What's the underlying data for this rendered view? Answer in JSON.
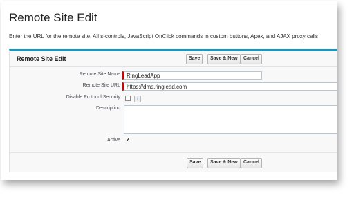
{
  "page": {
    "title": "Remote Site Edit",
    "intro": "Enter the URL for the remote site. All s-controls, JavaScript OnClick commands in custom buttons, Apex, and AJAX proxy calls"
  },
  "block": {
    "title": "Remote Site Edit",
    "buttons": {
      "save": "Save",
      "save_new": "Save & New",
      "cancel": "Cancel"
    }
  },
  "form": {
    "site_name": {
      "label": "Remote Site Name",
      "value": "RingLeadApp"
    },
    "site_url": {
      "label": "Remote Site URL",
      "value": "https://dms.ringlead.com"
    },
    "disable_protocol": {
      "label": "Disable Protocol Security",
      "checked": false,
      "info_icon": "i"
    },
    "description": {
      "label": "Description",
      "value": ""
    },
    "active": {
      "label": "Active",
      "checked": true,
      "check_mark": "✔"
    }
  },
  "colors": {
    "accent": "#1797c0",
    "required": "#cc0000"
  }
}
